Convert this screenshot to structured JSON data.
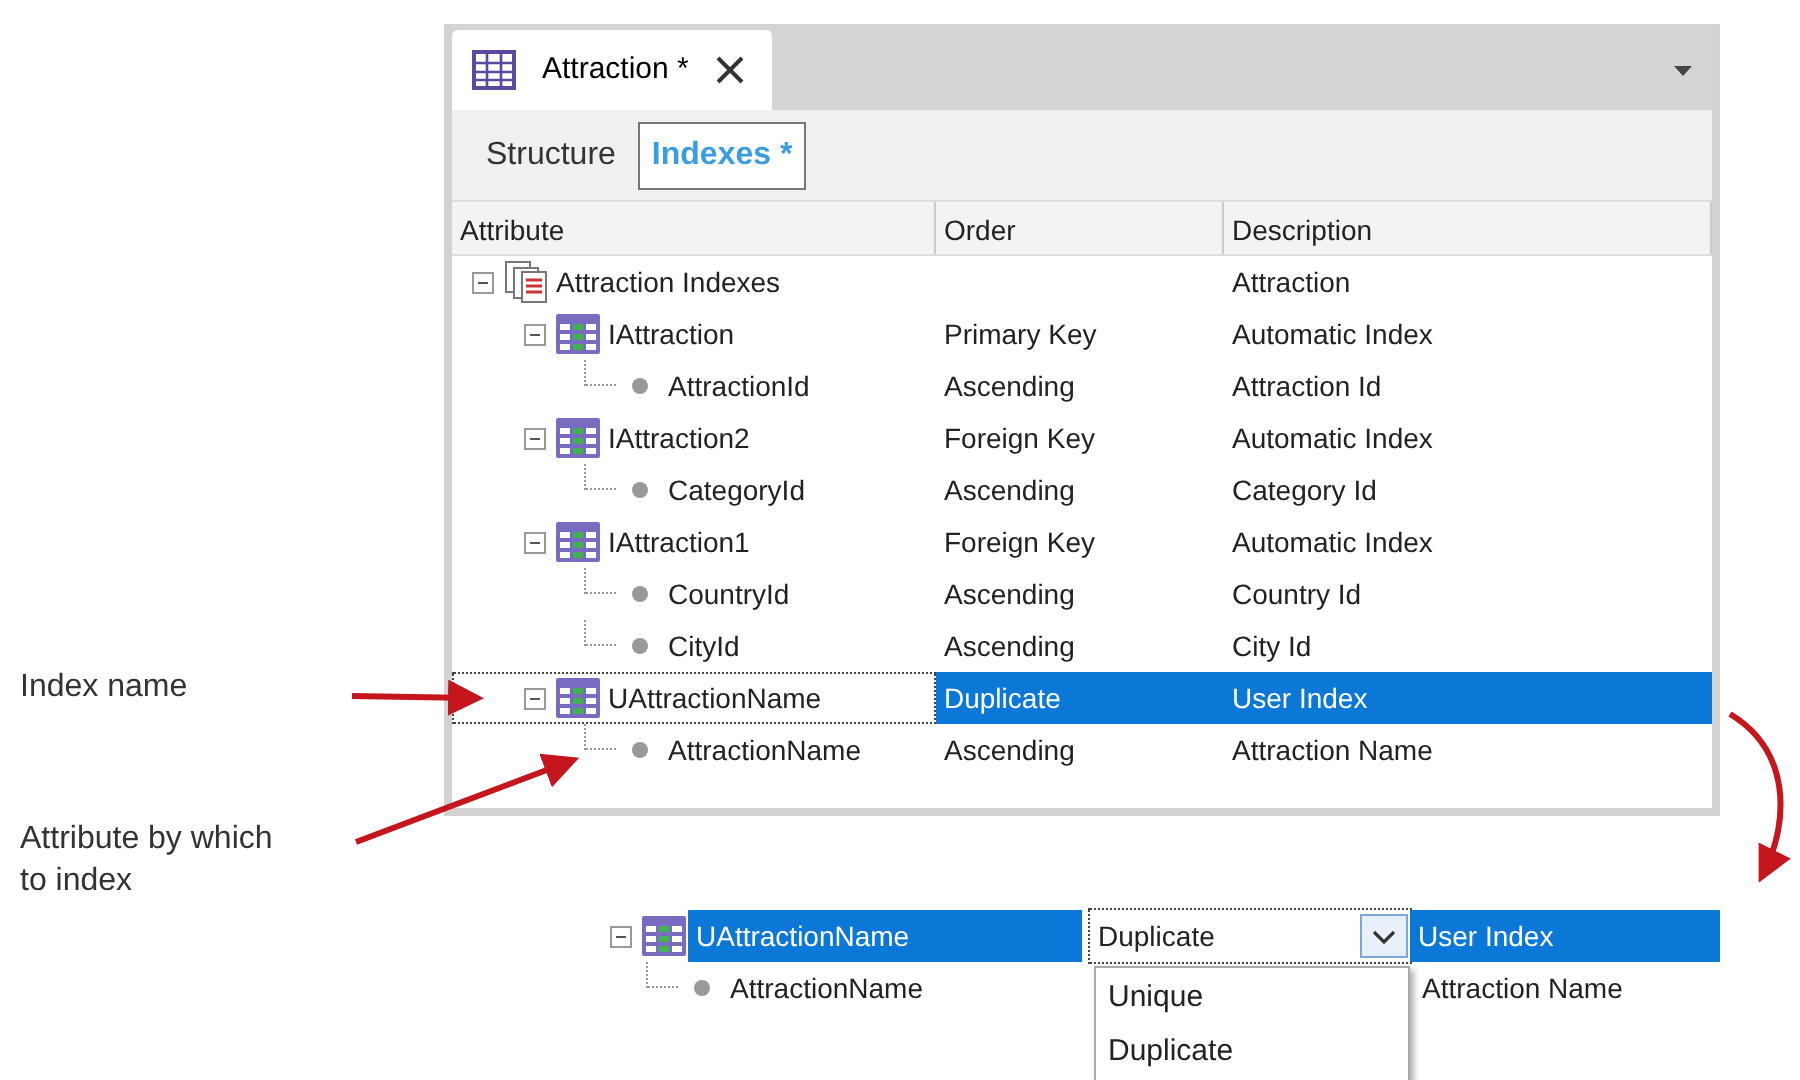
{
  "window": {
    "tab": {
      "title": "Attraction *",
      "selected": true
    },
    "subtabs": [
      {
        "label": "Structure",
        "selected": false
      },
      {
        "label": "Indexes *",
        "selected": true
      }
    ],
    "columns": [
      "Attribute",
      "Order",
      "Description"
    ],
    "tree": [
      {
        "kind": "group",
        "attribute": "Attraction Indexes",
        "description": "Attraction",
        "expanded": true,
        "selected": false,
        "children": [
          {
            "kind": "index",
            "attribute": "IAttraction",
            "order": "Primary Key",
            "description": "Automatic Index",
            "expanded": true,
            "selected": false,
            "children": [
              {
                "kind": "attribute",
                "attribute": "AttractionId",
                "order": "Ascending",
                "description": "Attraction Id",
                "selected": false
              }
            ]
          },
          {
            "kind": "index",
            "attribute": "IAttraction2",
            "order": "Foreign Key",
            "description": "Automatic Index",
            "expanded": true,
            "selected": false,
            "children": [
              {
                "kind": "attribute",
                "attribute": "CategoryId",
                "order": "Ascending",
                "description": "Category Id",
                "selected": false
              }
            ]
          },
          {
            "kind": "index",
            "attribute": "IAttraction1",
            "order": "Foreign Key",
            "description": "Automatic Index",
            "expanded": true,
            "selected": false,
            "children": [
              {
                "kind": "attribute",
                "attribute": "CountryId",
                "order": "Ascending",
                "description": "Country Id",
                "selected": false
              },
              {
                "kind": "attribute",
                "attribute": "CityId",
                "order": "Ascending",
                "description": "City Id",
                "selected": false
              }
            ]
          },
          {
            "kind": "index",
            "attribute": "UAttractionName",
            "order": "Duplicate",
            "description": "User Index",
            "expanded": true,
            "selected": true,
            "children": [
              {
                "kind": "attribute",
                "attribute": "AttractionName",
                "order": "Ascending",
                "description": "Attraction Name",
                "selected": false
              }
            ]
          }
        ]
      }
    ]
  },
  "callouts": [
    {
      "text": "Index name"
    },
    {
      "text": "Attribute by which to index"
    }
  ],
  "detail": {
    "index": {
      "attribute": "UAttractionName",
      "order": "Duplicate",
      "description": "User Index",
      "expanded": true,
      "selected": true
    },
    "attribute": {
      "attribute": "AttractionName",
      "description": "Attraction Name"
    },
    "dropdown": {
      "options": [
        "Unique",
        "Duplicate"
      ]
    }
  }
}
